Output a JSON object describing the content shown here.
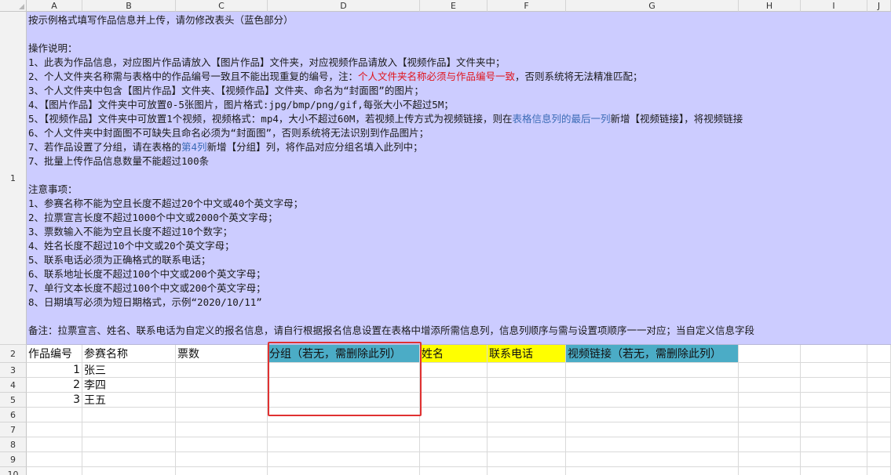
{
  "columns": [
    "A",
    "B",
    "C",
    "D",
    "E",
    "F",
    "G",
    "H",
    "I",
    "J"
  ],
  "rows": [
    "1",
    "2",
    "3",
    "4",
    "5",
    "6",
    "7",
    "8",
    "9",
    "10"
  ],
  "instructions": {
    "lines": [
      [
        {
          "t": "按示例格式填写作品信息并上传，请勿修改表头（蓝色部分）"
        }
      ],
      [
        {
          "t": ""
        }
      ],
      [
        {
          "t": "操作说明："
        }
      ],
      [
        {
          "t": "1、此表为作品信息，对应图片作品请放入【图片作品】文件夹，对应视频作品请放入【视频作品】文件夹中；"
        }
      ],
      [
        {
          "t": "2、个人文件夹名称需与表格中的作品编号一致且不能出现重复的编号，注："
        },
        {
          "t": "个人文件夹名称必须与作品编号一致",
          "c": "red"
        },
        {
          "t": "，否则系统将无法精准匹配；"
        }
      ],
      [
        {
          "t": "3、个人文件夹中包含【图片作品】文件夹、【视频作品】文件夹、命名为“封面图”的图片；"
        }
      ],
      [
        {
          "t": "4、【图片作品】文件夹中可放置0-5张图片，图片格式:jpg/bmp/png/gif,每张大小不超过5M；"
        }
      ],
      [
        {
          "t": "5、【视频作品】文件夹中可放置1个视频，视频格式：mp4，大小不超过60M，若视频上传方式为视频链接，则在"
        },
        {
          "t": "表格信息列的最后一列",
          "c": "blue"
        },
        {
          "t": "新增【视频链接】，将视频链接"
        }
      ],
      [
        {
          "t": "6、个人文件夹中封面图不可缺失且命名必须为“封面图”，否则系统将无法识别到作品图片；"
        }
      ],
      [
        {
          "t": "7、若作品设置了分组，请在表格的"
        },
        {
          "t": "第4列",
          "c": "blue"
        },
        {
          "t": "新增【分组】列，将作品对应分组名填入此列中；"
        }
      ],
      [
        {
          "t": "7、批量上传作品信息数量不能超过100条"
        }
      ],
      [
        {
          "t": ""
        }
      ],
      [
        {
          "t": "注意事项："
        }
      ],
      [
        {
          "t": "1、参赛名称不能为空且长度不超过20个中文或40个英文字母；"
        }
      ],
      [
        {
          "t": "2、拉票宣言长度不超过1000个中文或2000个英文字母；"
        }
      ],
      [
        {
          "t": "3、票数输入不能为空且长度不超过10个数字；"
        }
      ],
      [
        {
          "t": "4、姓名长度不超过10个中文或20个英文字母；"
        }
      ],
      [
        {
          "t": "5、联系电话必须为正确格式的联系电话；"
        }
      ],
      [
        {
          "t": "6、联系地址长度不超过100个中文或200个英文字母；"
        }
      ],
      [
        {
          "t": "7、单行文本长度不超过100个中文或200个英文字母；"
        }
      ],
      [
        {
          "t": "8、日期填写必须为短日期格式，示例“2020/10/11”"
        }
      ],
      [
        {
          "t": ""
        }
      ],
      [
        {
          "t": "备注：拉票宣言、姓名、联系电话为自定义的报名信息，请自行根据报名信息设置在表格中增添所需信息列，信息列顺序与需与设置项顺序一一对应；当自定义信息字段"
        }
      ]
    ]
  },
  "header_row": {
    "A": "作品编号",
    "B": "参赛名称",
    "C": "票数",
    "D": "分组（若无，需删除此列）",
    "E": "姓名",
    "F": "联系电话",
    "G": "视频链接（若无，需删除此列）"
  },
  "data_rows": [
    {
      "A": "1",
      "B": "张三"
    },
    {
      "A": "2",
      "B": "李四"
    },
    {
      "A": "3",
      "B": "王五"
    }
  ],
  "colors": {
    "instructions_bg": "#ccccff",
    "header_teal": "#4bacc6",
    "header_yellow": "#ffff00",
    "highlight_red": "#e03131"
  }
}
